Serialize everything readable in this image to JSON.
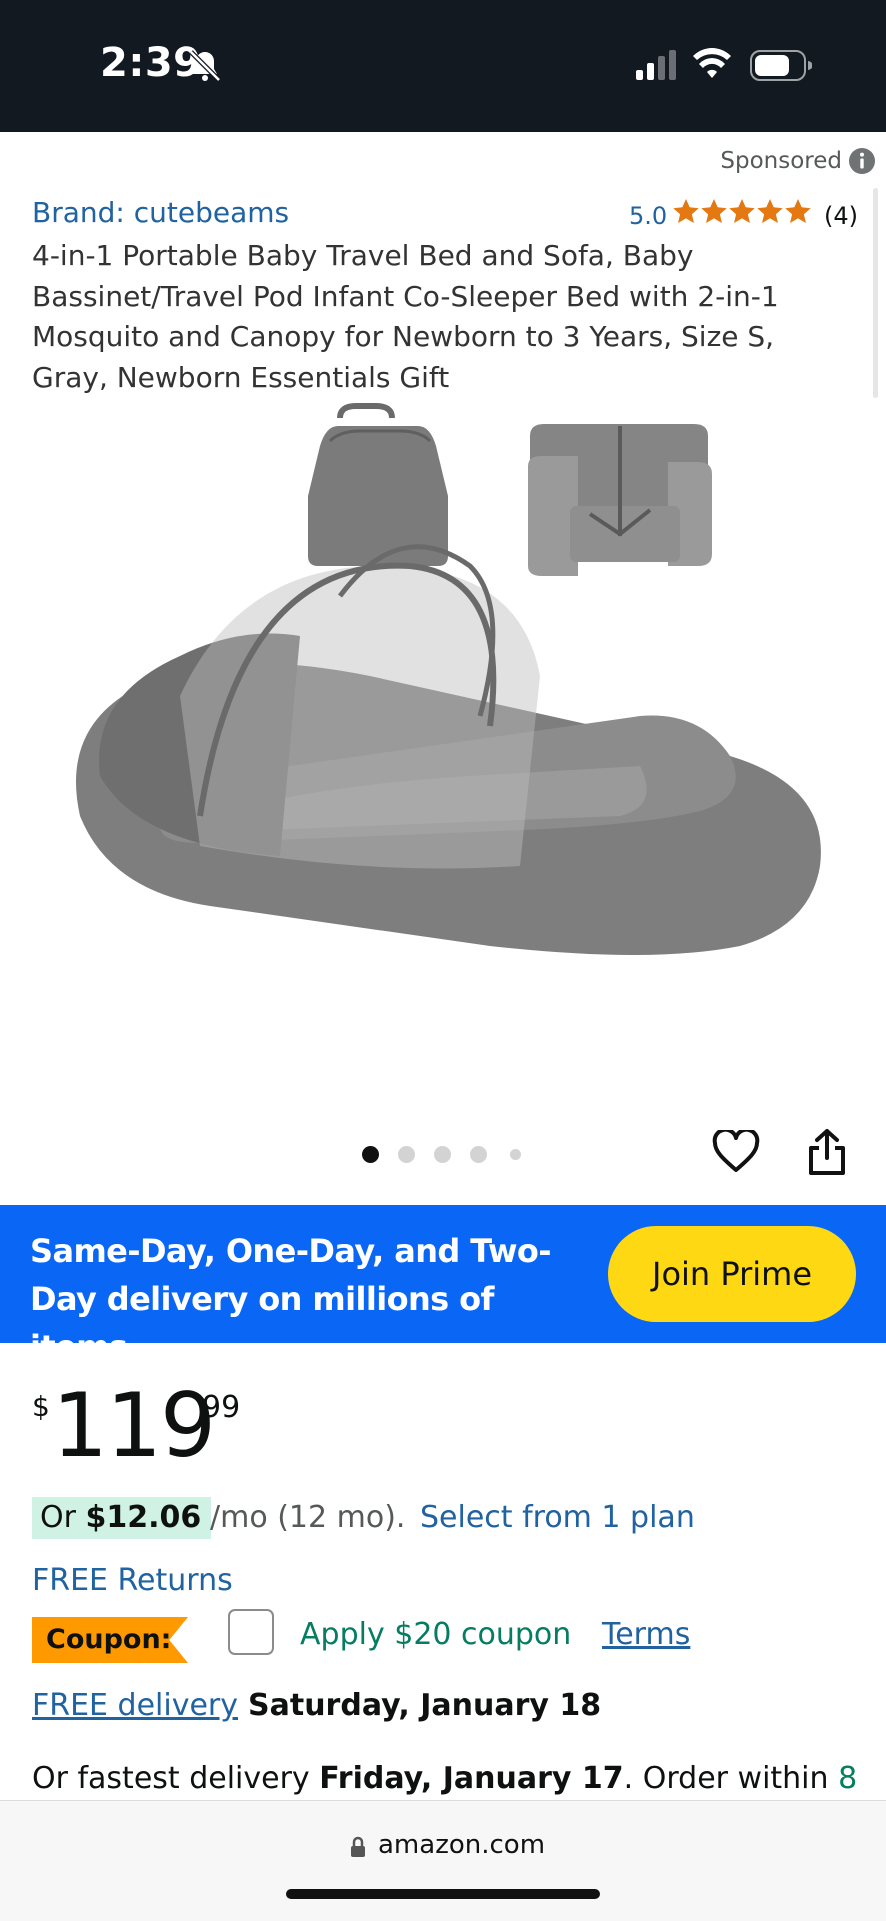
{
  "status_bar": {
    "time": "2:39"
  },
  "ad": {
    "label": "Sponsored"
  },
  "product": {
    "brand": "Brand: cutebeams",
    "rating": "5.0",
    "rating_count": "(4)",
    "title": "4-in-1 Portable Baby Travel Bed and Sofa, Baby Bassinet/Travel Pod Infant Co-Sleeper Bed with 2-in-1 Mosquito and Canopy for Newborn to 3 Years, Size S, Gray, Newborn Essentials Gift",
    "stars": 5
  },
  "carousel": {
    "count": 5,
    "active": 1
  },
  "prime_banner": {
    "text": "Same-Day, One-Day, and Two-Day delivery on millions of items",
    "button": "Join Prime"
  },
  "price": {
    "symbol": "$",
    "whole": "119",
    "fraction": "99"
  },
  "installment": {
    "prefix": "Or",
    "amount": "$12.06",
    "term": "/mo (12 mo).",
    "link": "Select from 1 plan"
  },
  "returns": "FREE Returns",
  "coupon": {
    "badge": "Coupon:",
    "apply": "Apply $20 coupon",
    "terms": "Terms"
  },
  "delivery": {
    "free_label": "FREE delivery",
    "date": "Saturday, January 18"
  },
  "fastest": {
    "prefix": "Or fastest delivery",
    "date": "Friday, January 17",
    "middle": ". Order within",
    "remaining": "8"
  },
  "browser": {
    "url": "amazon.com"
  },
  "colors": {
    "prime_blue": "#0a66f5",
    "prime_yellow": "#ffd814",
    "link_blue": "#2162a1",
    "star_orange": "#e47911",
    "coupon_orange": "#ff9900",
    "deal_green": "#067d62"
  }
}
